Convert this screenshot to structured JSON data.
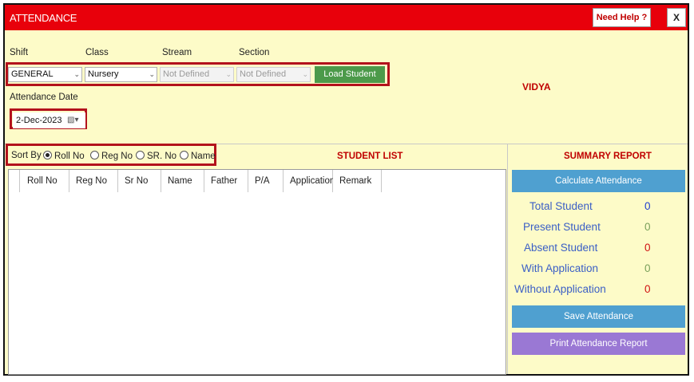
{
  "window": {
    "title": "ATTENDANCE",
    "help_label": "Need Help ?",
    "close_label": "X"
  },
  "filters": {
    "shift_label": "Shift",
    "class_label": "Class",
    "stream_label": "Stream",
    "section_label": "Section",
    "shift_value": "GENERAL",
    "class_value": "Nursery",
    "stream_value": "Not Defined",
    "section_value": "Not Defined",
    "load_button": "Load Student",
    "date_label": "Attendance Date",
    "date_value": "2-Dec-2023"
  },
  "school_name": "VIDYA",
  "sort": {
    "label": "Sort By",
    "options": [
      "Roll No",
      "Reg No",
      "SR. No",
      "Name"
    ],
    "selected": "Roll No"
  },
  "student_list": {
    "title": "STUDENT LIST",
    "columns": [
      "Roll No",
      "Reg No",
      "Sr No",
      "Name",
      "Father",
      "P/A",
      "Application",
      "Remark"
    ],
    "rows": []
  },
  "summary": {
    "title": "SUMMARY REPORT",
    "calculate_button": "Calculate Attendance",
    "items": [
      {
        "label": "Total Student",
        "value": "0",
        "color": "#1f3fd0"
      },
      {
        "label": "Present Student",
        "value": "0",
        "color": "#7aa05a"
      },
      {
        "label": "Absent Student",
        "value": "0",
        "color": "#d01010"
      },
      {
        "label": "With Application",
        "value": "0",
        "color": "#7aa05a"
      },
      {
        "label": "Without Application",
        "value": "0",
        "color": "#d01010"
      }
    ],
    "save_button": "Save Attendance",
    "print_button": "Print Attendance Report"
  },
  "colors": {
    "title_bar": "#e8000b",
    "background": "#fdfbc8",
    "highlight_border": "#b3121c",
    "load_button": "#4c9a4a",
    "action_button": "#4fa0d0",
    "print_button": "#9a78d4",
    "summary_label": "#3b5fc6"
  }
}
